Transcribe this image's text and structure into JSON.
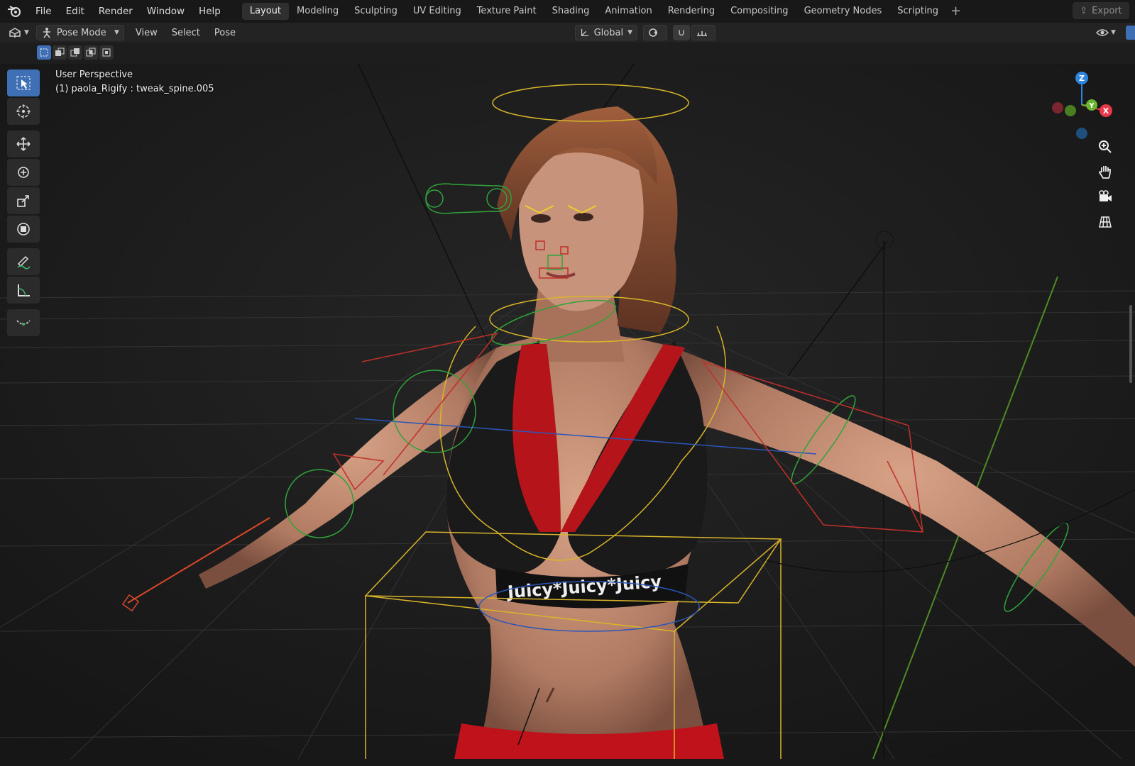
{
  "menu": {
    "items": [
      "File",
      "Edit",
      "Render",
      "Window",
      "Help"
    ]
  },
  "workspaces": {
    "tabs": [
      "Layout",
      "Modeling",
      "Sculpting",
      "UV Editing",
      "Texture Paint",
      "Shading",
      "Animation",
      "Rendering",
      "Compositing",
      "Geometry Nodes",
      "Scripting"
    ],
    "active": "Layout",
    "add_label": "+"
  },
  "export_label": "Export",
  "header": {
    "mode": "Pose Mode",
    "menus": [
      "View",
      "Select",
      "Pose"
    ],
    "orientation": "Global"
  },
  "viewport": {
    "perspective": "User Perspective",
    "active_object": "(1) paola_Rigify : tweak_spine.005",
    "gizmo_axes": [
      "Z",
      "Y",
      "X"
    ]
  },
  "scene_text": {
    "band_label": "Juicy*Juicy*Juicy"
  },
  "icons": {
    "toolbar": [
      "select-box-icon",
      "cursor-icon",
      "move-icon",
      "rotate-icon",
      "scale-icon",
      "transform-icon",
      "annotate-icon",
      "measure-icon",
      "relax-icon"
    ],
    "nav": [
      "zoom-icon",
      "hand-pan-icon",
      "camera-icon",
      "grid-icon"
    ]
  },
  "colors": {
    "accent": "#3f6fb5",
    "bone_yellow": "#d9b52a",
    "bone_red": "#c0302b",
    "bone_green": "#2fa33a",
    "bone_blue": "#2a56b8",
    "axis_x": "#e8394a",
    "axis_y": "#6bb52f",
    "axis_z": "#2f86e0"
  }
}
